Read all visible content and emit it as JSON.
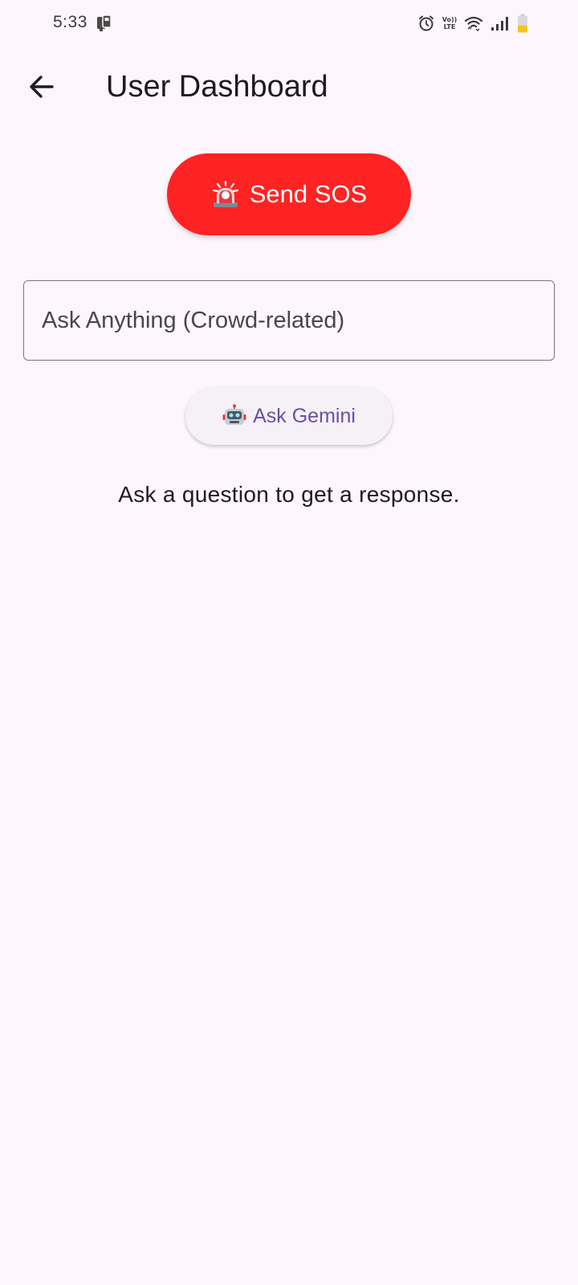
{
  "status_bar": {
    "time": "5:33",
    "volte_line1": "Vo))",
    "volte_line2": "LTE"
  },
  "app_bar": {
    "title": "User Dashboard",
    "back_icon": "arrow-back-icon"
  },
  "sos": {
    "label": "Send SOS",
    "icon": "rotating-light-icon",
    "color": "#ff2323"
  },
  "ask": {
    "placeholder": "Ask Anything (Crowd-related)",
    "value": ""
  },
  "gemini": {
    "label": "Ask Gemini",
    "icon": "robot-icon",
    "color": "#6750a4"
  },
  "response": {
    "text": "Ask a question to get a response."
  },
  "colors": {
    "background": "#fdf7fd",
    "outline": "#79747e",
    "battery": "#f5c518"
  }
}
